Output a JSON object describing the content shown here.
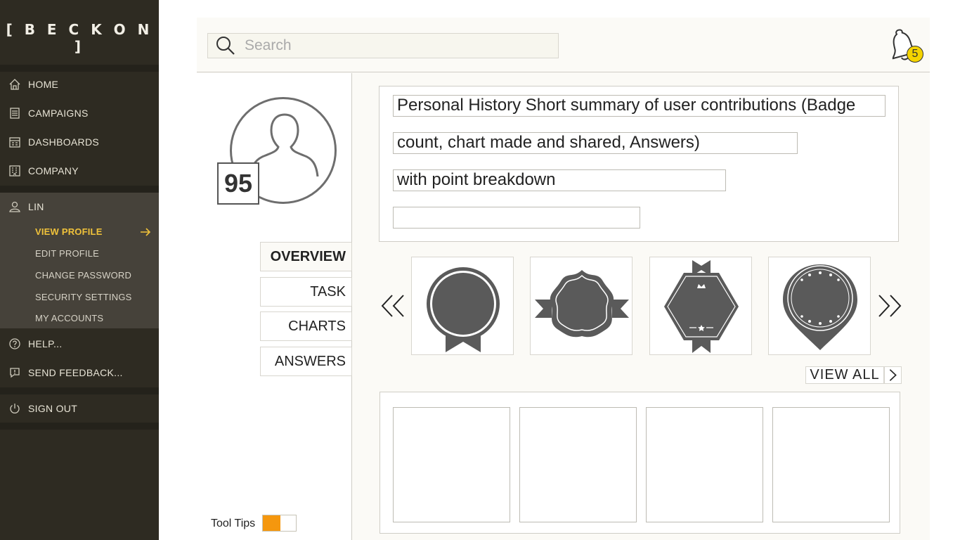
{
  "brand": {
    "logo_text": "[ B E C K O N ]"
  },
  "sidebar": {
    "items": [
      {
        "label": "HOME",
        "icon": "home-icon"
      },
      {
        "label": "CAMPAIGNS",
        "icon": "campaigns-icon"
      },
      {
        "label": "DASHBOARDS",
        "icon": "dashboards-icon"
      },
      {
        "label": "COMPANY",
        "icon": "company-icon"
      },
      {
        "label": "LIN",
        "icon": "user-icon"
      },
      {
        "label": "HELP...",
        "icon": "help-icon"
      },
      {
        "label": "SEND FEEDBACK...",
        "icon": "feedback-icon"
      },
      {
        "label": "SIGN OUT",
        "icon": "power-icon"
      }
    ],
    "sub_items": [
      {
        "label": "VIEW PROFILE",
        "active": true
      },
      {
        "label": "EDIT PROFILE"
      },
      {
        "label": "CHANGE PASSWORD"
      },
      {
        "label": "SECURITY SETTINGS"
      },
      {
        "label": "MY ACCOUNTS"
      }
    ],
    "accent_color": "#f0c23a"
  },
  "search": {
    "placeholder": "Search"
  },
  "notifications": {
    "count": "5",
    "badge_color": "#f5d400"
  },
  "profile": {
    "score": "95"
  },
  "tabs": [
    {
      "label": "OVERVIEW",
      "active": true
    },
    {
      "label": "TASK"
    },
    {
      "label": "CHARTS"
    },
    {
      "label": "ANSWERS"
    }
  ],
  "summary": {
    "lines": [
      "Personal History Short summary of user contributions (Badge",
      "count, chart made and shared, Answers)",
      "with point breakdown",
      ""
    ]
  },
  "badges": {
    "items": [
      {
        "name": "rosette-badge"
      },
      {
        "name": "ribbon-seal-badge"
      },
      {
        "name": "hexagon-crown-badge"
      },
      {
        "name": "star-pin-badge"
      }
    ],
    "view_all_label": "VIEW ALL"
  },
  "tooltips": {
    "label": "Tool Tips",
    "enabled": true,
    "toggle_color": "#f5970e"
  }
}
